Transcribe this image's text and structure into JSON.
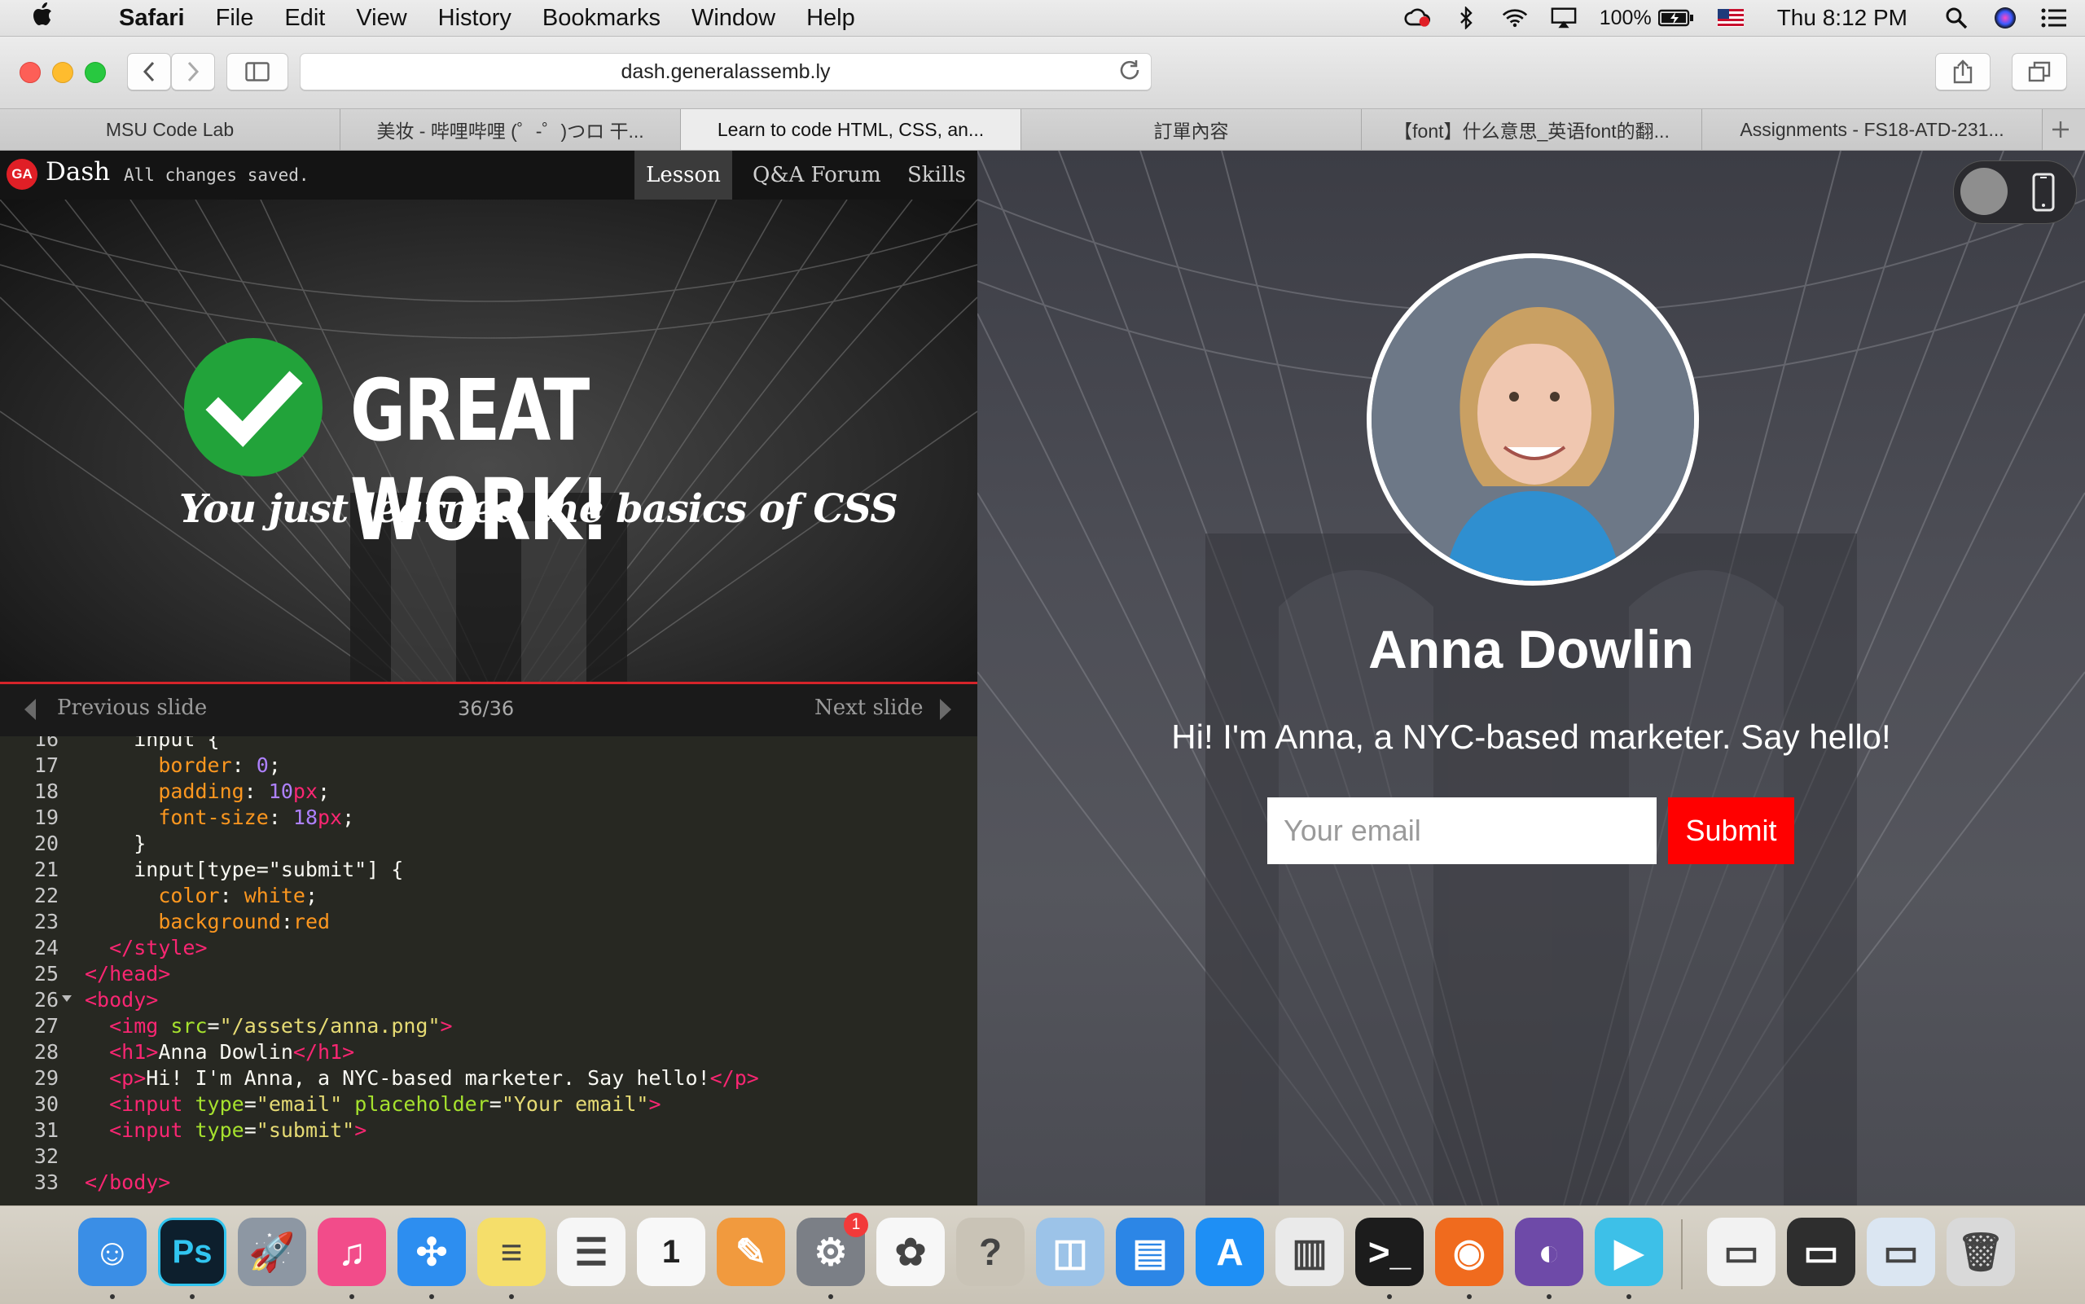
{
  "menubar": {
    "apple": "",
    "items": [
      "Safari",
      "File",
      "Edit",
      "View",
      "History",
      "Bookmarks",
      "Window",
      "Help"
    ],
    "battery": "100%",
    "clock": "Thu 8:12 PM"
  },
  "browser": {
    "url": "dash.generalassemb.ly",
    "tabs": [
      {
        "label": "MSU Code Lab"
      },
      {
        "label": "美妆 - 哔哩哔哩 (゜-゜)つロ 干..."
      },
      {
        "label": "Learn to code HTML, CSS, an..."
      },
      {
        "label": "訂單內容"
      },
      {
        "label": "【font】什么意思_英语font的翻..."
      },
      {
        "label": "Assignments - FS18-ATD-231..."
      }
    ],
    "active_tab": 2
  },
  "dash": {
    "logo": "GA",
    "name": "Dash",
    "status": "All changes saved.",
    "nav": [
      "Lesson",
      "Q&A Forum",
      "Skills"
    ],
    "slide": {
      "headline": "GREAT WORK!",
      "subline": "You just learned the basics of CSS",
      "progress": 1.0
    },
    "slidenav": {
      "prev": "Previous slide",
      "counter": "36/36",
      "next": "Next slide"
    }
  },
  "editor": {
    "lines": [
      {
        "n": "16",
        "html": "    input {"
      },
      {
        "n": "17",
        "html": "      <span class='t-prop'>border</span>: <span class='t-num'>0</span>;"
      },
      {
        "n": "18",
        "html": "      <span class='t-prop'>padding</span>: <span class='t-num'>10</span><span class='t-tag'>px</span>;"
      },
      {
        "n": "19",
        "html": "      <span class='t-prop'>font-size</span>: <span class='t-num'>18</span><span class='t-tag'>px</span>;"
      },
      {
        "n": "20",
        "html": "    }"
      },
      {
        "n": "21",
        "html": "    input[type=\"submit\"] {"
      },
      {
        "n": "22",
        "html": "      <span class='t-prop'>color</span>: <span class='t-prop'>white</span>;"
      },
      {
        "n": "23",
        "html": "      <span class='t-prop'>background</span>:<span class='t-prop'>red</span>"
      },
      {
        "n": "24",
        "html": "  <span class='t-tag'>&lt;/style&gt;</span>"
      },
      {
        "n": "25",
        "html": "<span class='t-tag'>&lt;/head&gt;</span>"
      },
      {
        "n": "26",
        "html": "<span class='t-tag'>&lt;body&gt;</span>"
      },
      {
        "n": "27",
        "html": "  <span class='t-tag'>&lt;img</span> <span class='t-attr'>src</span>=<span class='t-str'>\"/assets/anna.png\"</span><span class='t-tag'>&gt;</span>"
      },
      {
        "n": "28",
        "html": "  <span class='t-tag'>&lt;h1&gt;</span>Anna Dowlin<span class='t-tag'>&lt;/h1&gt;</span>"
      },
      {
        "n": "29",
        "html": "  <span class='t-tag'>&lt;p&gt;</span>Hi! I'm Anna, a NYC-based marketer. Say hello!<span class='t-tag'>&lt;/p&gt;</span>"
      },
      {
        "n": "30",
        "html": "  <span class='t-tag'>&lt;input</span> <span class='t-attr'>type</span>=<span class='t-str'>\"email\"</span> <span class='t-attr'>placeholder</span>=<span class='t-str'>\"Your email\"</span><span class='t-tag'>&gt;</span>"
      },
      {
        "n": "31",
        "html": "  <span class='t-tag'>&lt;input</span> <span class='t-attr'>type</span>=<span class='t-str'>\"submit\"</span><span class='t-tag'>&gt;</span>"
      },
      {
        "n": "32",
        "html": ""
      },
      {
        "n": "33",
        "html": "<span class='t-tag'>&lt;/body&gt;</span>"
      }
    ]
  },
  "preview": {
    "name": "Anna Dowlin",
    "bio": "Hi! I'm Anna, a NYC-based marketer. Say hello!",
    "email_placeholder": "Your email",
    "submit_label": "Submit"
  },
  "dock": {
    "apps": [
      {
        "name": "finder-icon",
        "glyph": "☺",
        "color": "#3a8ee6"
      },
      {
        "name": "photoshop-icon",
        "glyph": "Ps",
        "color": "#0d1f2d"
      },
      {
        "name": "launchpad-icon",
        "glyph": "🚀",
        "color": "#8d97a3"
      },
      {
        "name": "itunes-icon",
        "glyph": "♫",
        "color": "#f24c8a"
      },
      {
        "name": "safari-icon",
        "glyph": "✣",
        "color": "#2d8ef0"
      },
      {
        "name": "notes-icon",
        "glyph": "≡",
        "color": "#f5de6a"
      },
      {
        "name": "reminders-icon",
        "glyph": "☰",
        "color": "#f6f6f6"
      },
      {
        "name": "calendar-icon",
        "glyph": "1",
        "color": "#f8f8f8"
      },
      {
        "name": "pages-icon",
        "glyph": "✎",
        "color": "#f19a3e"
      },
      {
        "name": "system-preferences-icon",
        "glyph": "⚙",
        "color": "#7b7f86"
      },
      {
        "name": "photos-icon",
        "glyph": "✿",
        "color": "#f7f7f7"
      },
      {
        "name": "help-icon",
        "glyph": "?",
        "color": "#c9c3b6"
      },
      {
        "name": "preview-icon",
        "glyph": "◫",
        "color": "#9cc3e8"
      },
      {
        "name": "keynote-icon",
        "glyph": "▤",
        "color": "#2c86e6"
      },
      {
        "name": "app-store-icon",
        "glyph": "A",
        "color": "#1e8ff5"
      },
      {
        "name": "numbers-icon",
        "glyph": "▥",
        "color": "#eaeaea"
      },
      {
        "name": "terminal-icon",
        "glyph": ">_",
        "color": "#1c1c1c"
      },
      {
        "name": "firefox-icon",
        "glyph": "◉",
        "color": "#f06b1e"
      },
      {
        "name": "github-desktop-icon",
        "glyph": "◐",
        "color": "#6e4aa8"
      },
      {
        "name": "video-player-icon",
        "glyph": "▶",
        "color": "#3dc0e8"
      },
      {
        "name": "window-thumb-1-icon",
        "glyph": "▭",
        "color": "#f2f2f2"
      },
      {
        "name": "window-thumb-2-icon",
        "glyph": "▭",
        "color": "#2e2e2e"
      },
      {
        "name": "window-thumb-3-icon",
        "glyph": "▭",
        "color": "#dbe6f2"
      },
      {
        "name": "trash-icon",
        "glyph": "🗑",
        "color": "#d9d9d9"
      }
    ],
    "badge": "1"
  }
}
